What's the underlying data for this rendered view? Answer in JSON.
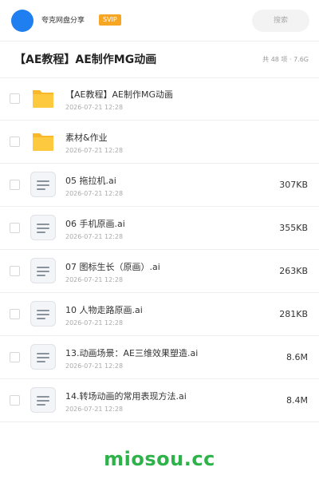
{
  "header": {
    "username": "夸克网盘分享",
    "badge": "SVIP",
    "search_placeholder": "搜索"
  },
  "titlebar": {
    "title": "【AE教程】AE制作MG动画",
    "meta": "共 48 项 · 7.6G"
  },
  "files": [
    {
      "type": "folder",
      "name": "【AE教程】AE制作MG动画",
      "date": "2026-07-21 12:28",
      "size": ""
    },
    {
      "type": "folder",
      "name": "素材&作业",
      "date": "2026-07-21 12:28",
      "size": ""
    },
    {
      "type": "file",
      "name": "05 拖拉机.ai",
      "date": "2026-07-21 12:28",
      "size": "307KB"
    },
    {
      "type": "file",
      "name": "06 手机原画.ai",
      "date": "2026-07-21 12:28",
      "size": "355KB"
    },
    {
      "type": "file",
      "name": "07 图标生长（原画）.ai",
      "date": "2026-07-21 12:28",
      "size": "263KB"
    },
    {
      "type": "file",
      "name": "10 人物走路原画.ai",
      "date": "2026-07-21 12:28",
      "size": "281KB"
    },
    {
      "type": "file",
      "name": "13.动画场景：AE三维效果塑造.ai",
      "date": "2026-07-21 12:28",
      "size": "8.6M"
    },
    {
      "type": "file",
      "name": "14.转场动画的常用表现方法.ai",
      "date": "2026-07-21 12:28",
      "size": "8.4M"
    }
  ],
  "icons": {
    "folder": "folder-icon",
    "file": "document-icon"
  },
  "colors": {
    "avatar": "#1f7ef0",
    "badge": "#f6a623",
    "folder": "#fcc93f",
    "watermark": "#2db34a"
  },
  "watermark": "miosou.cc"
}
